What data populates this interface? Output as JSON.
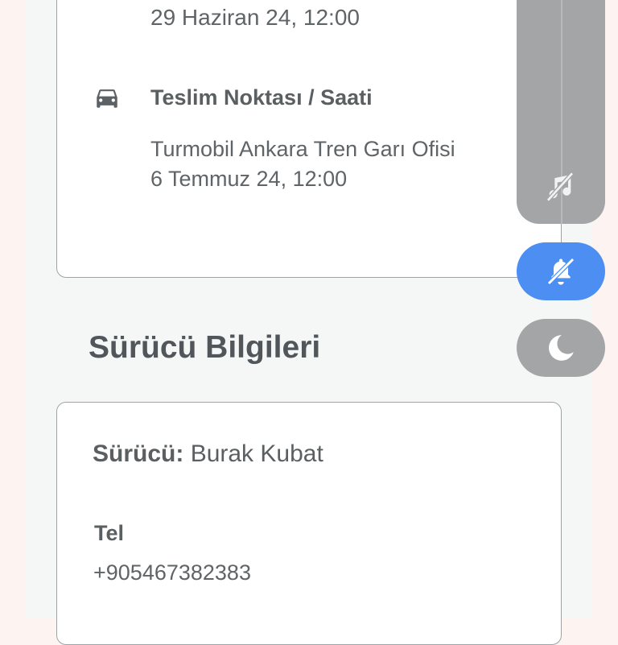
{
  "reservation": {
    "pickup_date": "29 Haziran 24, 12:00",
    "dropoff_title": "Teslim Noktası / Saati",
    "dropoff_location": "Turmobil Ankara Tren Garı Ofisi",
    "dropoff_date": "6 Temmuz 24, 12:00"
  },
  "driver_section": {
    "title": "Sürücü Bilgileri",
    "driver_label": "Sürücü:",
    "driver_name": "Burak Kubat",
    "tel_label": "Tel",
    "tel_value": "+905467382383"
  },
  "overlay": {
    "icons": [
      "music-off-icon",
      "bell-off-icon",
      "moon-icon"
    ],
    "colors": {
      "panel": "#a3a5a7",
      "active": "#4d8ef3"
    }
  }
}
